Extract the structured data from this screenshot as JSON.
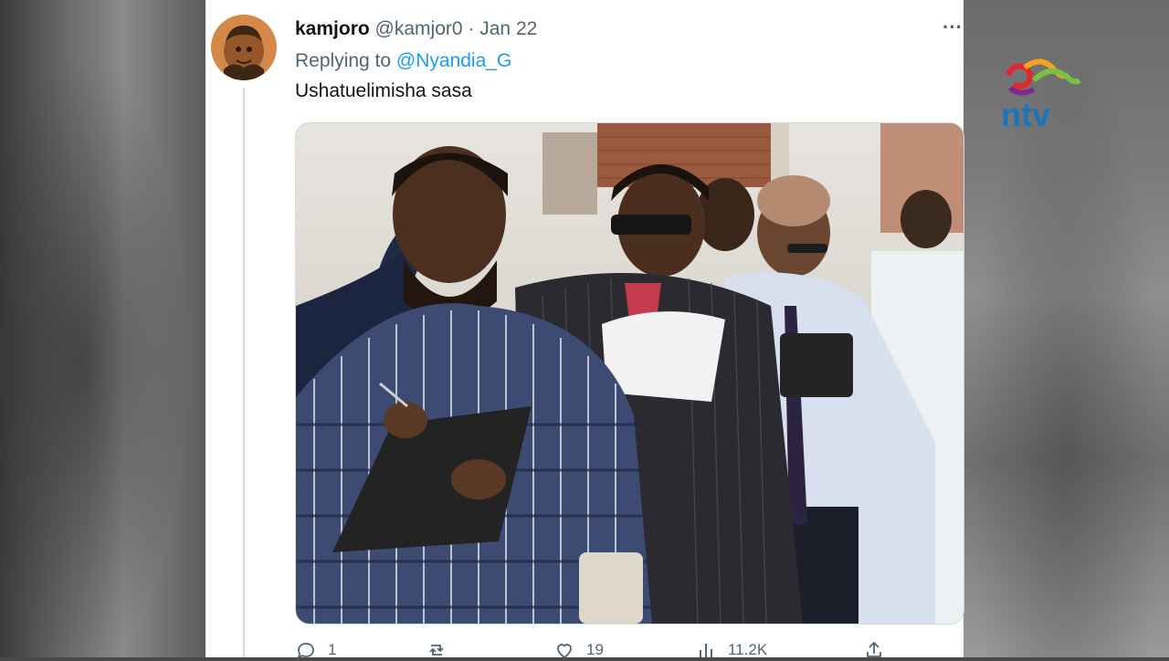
{
  "tweet": {
    "display_name": "kamjoro",
    "handle": "@kamjor0",
    "separator": "·",
    "date": "Jan 22",
    "replying_prefix": "Replying to",
    "replying_to": "@Nyandia_G",
    "text": "Ushatuelimisha sasa",
    "more_icon": "more-horizontal-icon",
    "actions": {
      "reply_count": "1",
      "retweet_count": "",
      "like_count": "19",
      "views_count": "11.2K",
      "share_count": ""
    }
  },
  "overlay": {
    "brand_logo": "ntv",
    "brand_colors": [
      "#e3262e",
      "#f7a21b",
      "#7ac143",
      "#7b2d8e",
      "#1c75bc"
    ]
  }
}
